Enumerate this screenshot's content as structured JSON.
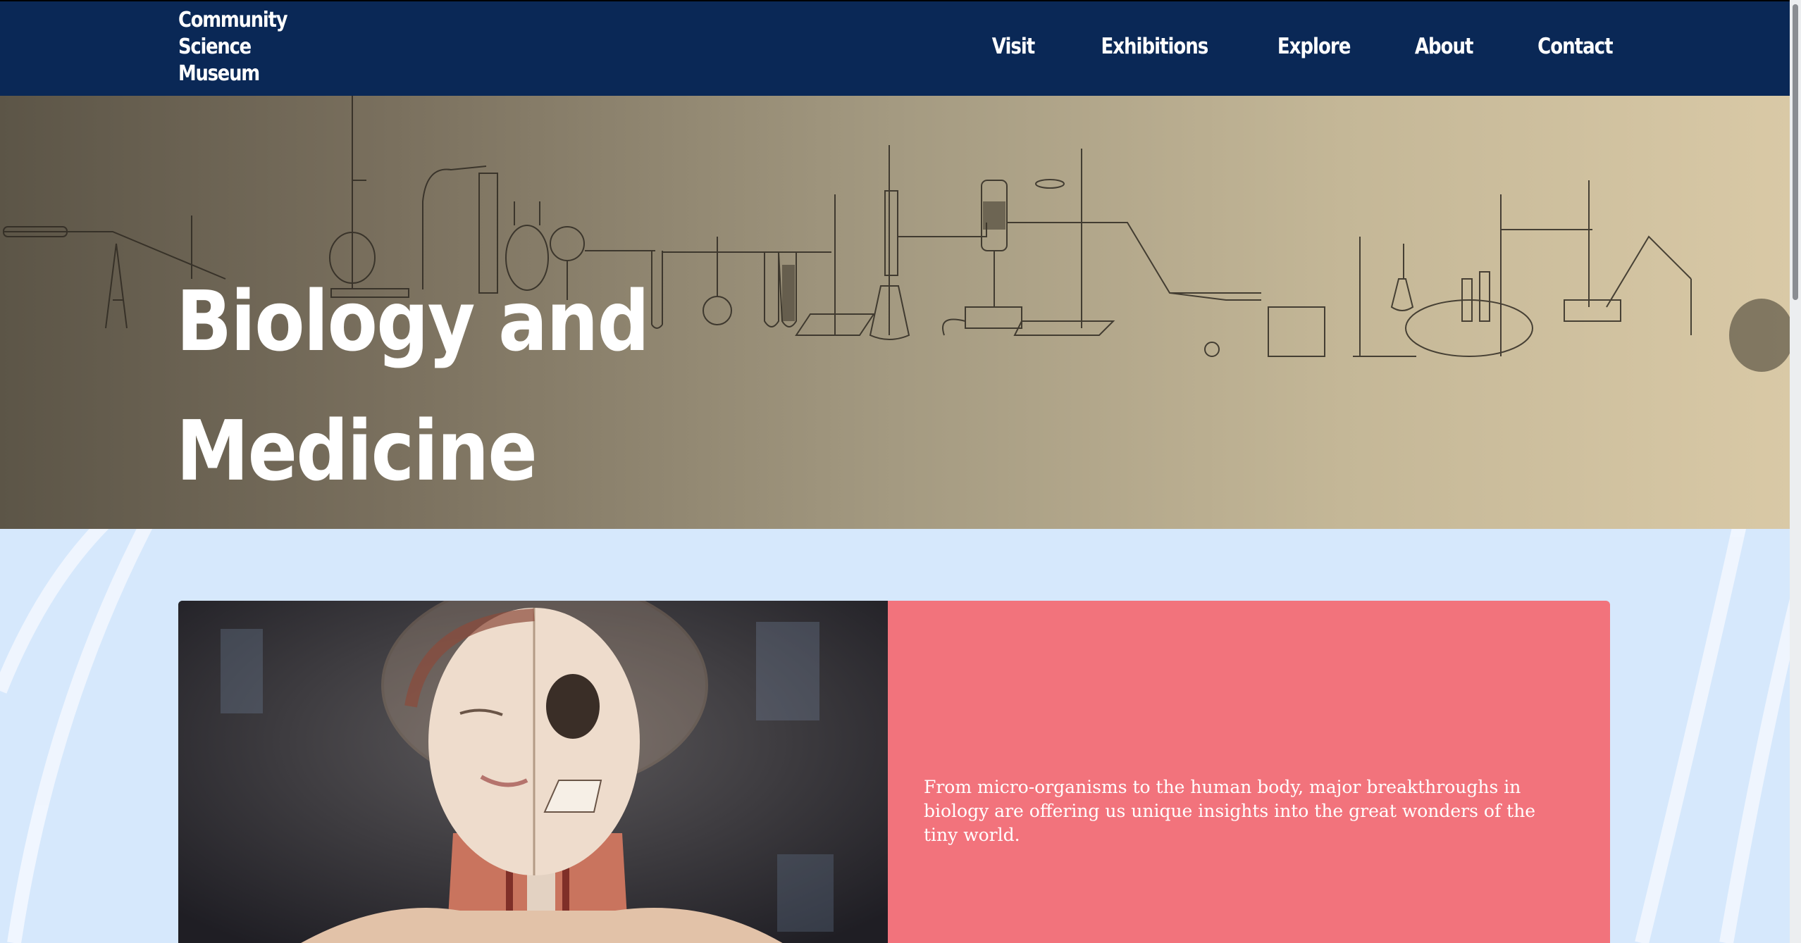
{
  "site": {
    "logo_lines": [
      "Community",
      "Science",
      "Museum"
    ]
  },
  "nav": {
    "items": [
      {
        "label": "Visit"
      },
      {
        "label": "Exhibitions"
      },
      {
        "label": "Explore"
      },
      {
        "label": "About"
      },
      {
        "label": "Contact"
      }
    ]
  },
  "hero": {
    "title_line1": "Biology and",
    "title_line2": "Medicine"
  },
  "feature": {
    "text": "From micro-organisms to the human body, major breakthroughs in biology are offering us unique insights into the great wonders of the tiny world."
  },
  "colors": {
    "header_bg": "#0a2856",
    "panel_bg": "#f2737c",
    "page_bg": "#d6e8fc"
  }
}
